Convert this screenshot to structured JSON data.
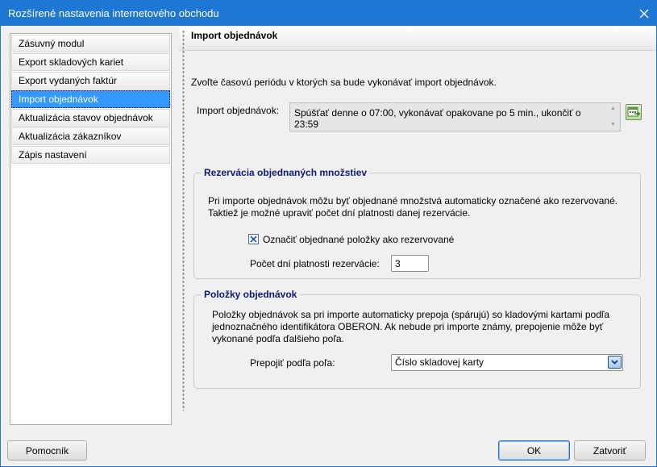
{
  "window": {
    "title": "Rozšírené nastavenia internetového obchodu"
  },
  "nav": {
    "items": [
      {
        "label": "Zásuvný modul"
      },
      {
        "label": "Export skladových kariet"
      },
      {
        "label": "Export vydaných faktúr"
      },
      {
        "label": "Import objednávok",
        "selected": true
      },
      {
        "label": "Aktualizácia stavov objednávok"
      },
      {
        "label": "Aktualizácia zákazníkov"
      },
      {
        "label": "Zápis nastavení"
      }
    ]
  },
  "content": {
    "title": "Import objednávok",
    "intro": "Zvoľte časovú periódu v ktorých sa bude vykonávať import objednávok.",
    "import_label": "Import objednávok:",
    "schedule_text": "Spúšťať denne o 07:00, vykonávať opakovane po 5 min., ukončiť o 23:59"
  },
  "reservation": {
    "title": "Rezervácia objednaných množstiev",
    "description": "Pri importe objednávok môžu byť objednané množstvá automaticky označené ako rezervované. Taktiež je možné upraviť počet dní platnosti danej rezervácie.",
    "checkbox_label": "Označiť objednané položky ako rezervované",
    "checkbox_checked": true,
    "days_label": "Počet dní platnosti rezervácie:",
    "days_value": "3"
  },
  "items": {
    "title": "Položky objednávok",
    "description": "Položky objednávok sa pri importe automaticky prepoja (spárujú) so kladovými kartami podľa jednoznačného identifikátora OBERON. Ak nebude pri importe známy, prepojenie môže byť vykonané podľa ďalšieho poľa.",
    "link_label": "Prepojiť podľa poľa:",
    "link_value": "Číslo skladovej karty"
  },
  "footer": {
    "help_label": "Pomocník",
    "ok_label": "OK",
    "close_label": "Zatvoriť"
  },
  "colors": {
    "titlebar": "#1e77d3",
    "selected_item": "#3399ff",
    "group_title": "#0d1a73"
  }
}
